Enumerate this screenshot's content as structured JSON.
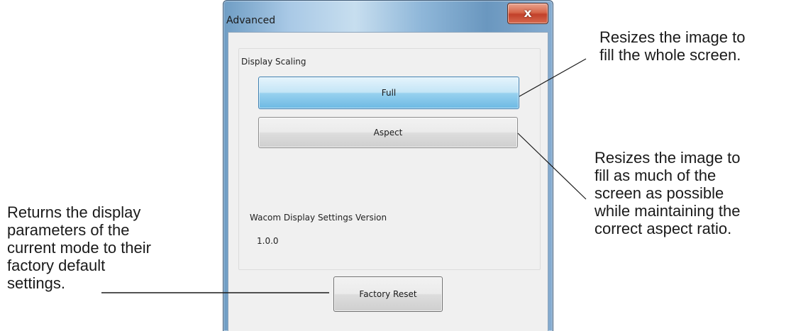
{
  "window": {
    "title": "Advanced",
    "close_label": "x"
  },
  "display_scaling": {
    "label": "Display Scaling",
    "full_label": "Full",
    "aspect_label": "Aspect",
    "selected": "Full"
  },
  "version": {
    "label": "Wacom Display Settings Version",
    "value": "1.0.0"
  },
  "factory_reset": {
    "label": "Factory Reset"
  },
  "callouts": {
    "full": "Resizes the image to\nfill the whole screen.",
    "aspect": "Resizes the image to\nfill as much of the\nscreen as possible\nwhile maintaining the\ncorrect aspect ratio.",
    "reset": "Returns the display\nparameters of the\ncurrent mode to their\nfactory default\nsettings."
  },
  "colors": {
    "selected_button": "#98d1ef",
    "close_button": "#c1402a",
    "title_bar": "#a9c9e6"
  }
}
